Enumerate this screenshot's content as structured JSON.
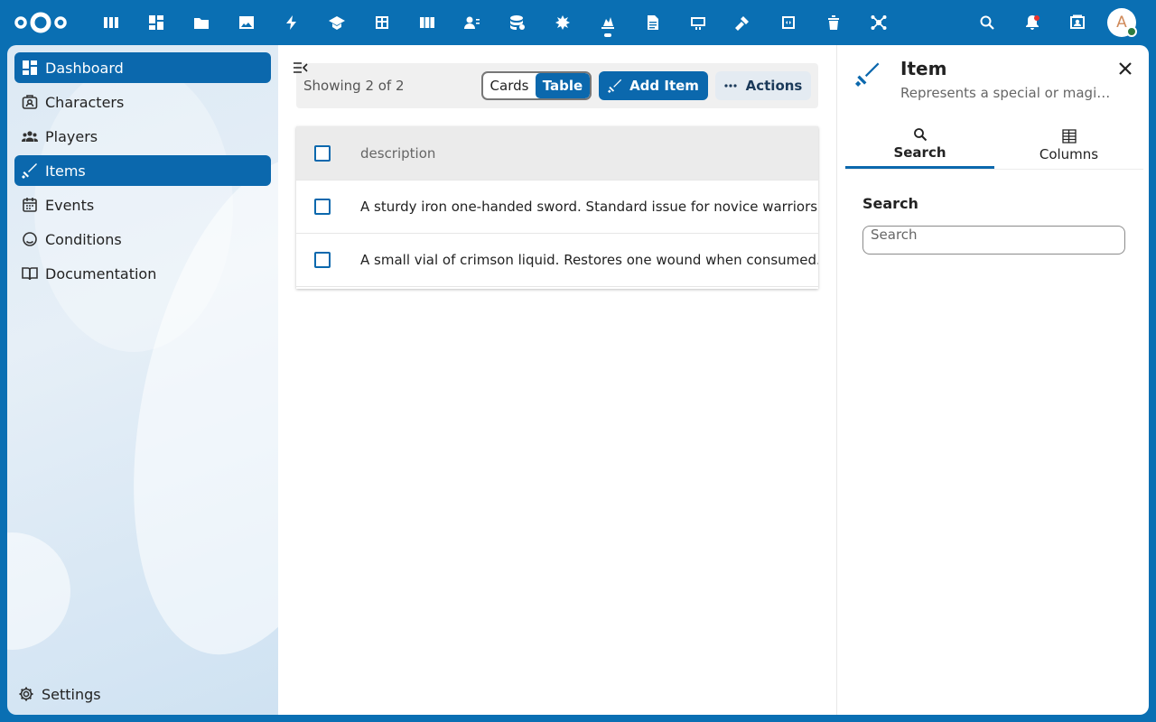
{
  "header": {
    "apps": [
      {
        "icon": "apps-grid-icon"
      },
      {
        "icon": "dashboard-icon"
      },
      {
        "icon": "files-icon"
      },
      {
        "icon": "photos-icon"
      },
      {
        "icon": "activity-icon"
      },
      {
        "icon": "learning-icon"
      },
      {
        "icon": "spreadsheet-icon"
      },
      {
        "icon": "deck-icon"
      },
      {
        "icon": "contacts-icon"
      },
      {
        "icon": "database-icon"
      },
      {
        "icon": "tools-icon"
      },
      {
        "icon": "game-icon",
        "active": true
      },
      {
        "icon": "text-icon"
      },
      {
        "icon": "whiteboard-icon"
      },
      {
        "icon": "hammer-icon"
      },
      {
        "icon": "code-icon"
      },
      {
        "icon": "trash-icon"
      },
      {
        "icon": "network-icon"
      }
    ],
    "avatar_initial": "A"
  },
  "sidebar": {
    "items": [
      {
        "label": "Dashboard",
        "icon": "dashboard-icon",
        "active": true
      },
      {
        "label": "Characters",
        "icon": "character-icon"
      },
      {
        "label": "Players",
        "icon": "players-icon"
      },
      {
        "label": "Items",
        "icon": "sword-icon",
        "active": true
      },
      {
        "label": "Events",
        "icon": "calendar-icon"
      },
      {
        "label": "Conditions",
        "icon": "conditions-icon"
      },
      {
        "label": "Documentation",
        "icon": "book-icon"
      }
    ],
    "settings_label": "Settings"
  },
  "main": {
    "showing": "Showing 2 of 2",
    "view_cards": "Cards",
    "view_table": "Table",
    "add_item_label": "Add Item",
    "actions_label": "Actions",
    "table": {
      "columns": [
        "description"
      ],
      "rows": [
        [
          "A sturdy iron one-handed sword. Standard issue for novice warriors."
        ],
        [
          "A small vial of crimson liquid. Restores one wound when consumed."
        ]
      ]
    }
  },
  "panel": {
    "title": "Item",
    "subtitle": "Represents a special or magi…",
    "tabs": [
      {
        "label": "Search",
        "icon": "search-icon"
      },
      {
        "label": "Columns",
        "icon": "columns-icon"
      }
    ],
    "search_label": "Search",
    "search_placeholder": "Search"
  },
  "colors": {
    "brand": "#0a6fb3",
    "primary": "#0b68ad"
  }
}
